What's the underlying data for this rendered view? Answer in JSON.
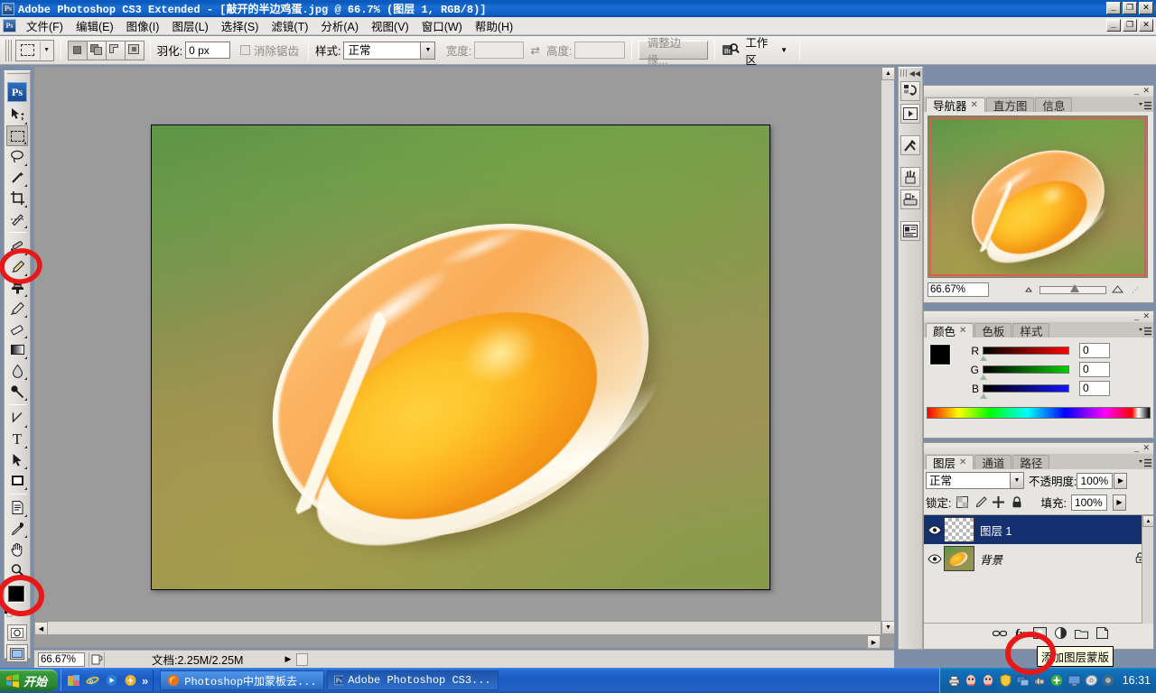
{
  "window": {
    "app_title": "Adobe Photoshop CS3 Extended - [敲开的半边鸡蛋.jpg @ 66.7% (图层 1, RGB/8)]",
    "minimize": "_",
    "maximize": "❐",
    "close": "✕"
  },
  "menubar": {
    "items": [
      {
        "label": "文件(F)"
      },
      {
        "label": "编辑(E)"
      },
      {
        "label": "图像(I)"
      },
      {
        "label": "图层(L)"
      },
      {
        "label": "选择(S)"
      },
      {
        "label": "滤镜(T)"
      },
      {
        "label": "分析(A)"
      },
      {
        "label": "视图(V)"
      },
      {
        "label": "窗口(W)"
      },
      {
        "label": "帮助(H)"
      }
    ]
  },
  "options_bar": {
    "tool": "rectangular-marquee",
    "feather_label": "羽化:",
    "feather_value": "0 px",
    "antialias_label": "消除锯齿",
    "antialias_checked": false,
    "style_label": "样式:",
    "style_value": "正常",
    "width_label": "宽度:",
    "width_value": "",
    "height_label": "高度:",
    "height_value": "",
    "swap_icon": "⇄",
    "refine_edge": "调整边缘...",
    "bridge_icon": "Br",
    "workspace_label": "工作区",
    "workspace_arrow": "▼"
  },
  "toolbox": {
    "logo": "Ps",
    "tools": [
      {
        "name": "move-tool",
        "glyph": "move"
      },
      {
        "name": "rectangular-marquee-tool",
        "glyph": "marquee",
        "selected": true
      },
      {
        "name": "lasso-tool",
        "glyph": "lasso"
      },
      {
        "name": "magic-wand-tool",
        "glyph": "wand"
      },
      {
        "name": "crop-tool",
        "glyph": "crop"
      },
      {
        "name": "slice-tool",
        "glyph": "slice"
      },
      {
        "name": "healing-brush-tool",
        "glyph": "heal"
      },
      {
        "name": "brush-tool",
        "glyph": "brush",
        "annotated": true
      },
      {
        "name": "clone-stamp-tool",
        "glyph": "stamp"
      },
      {
        "name": "history-brush-tool",
        "glyph": "historybrush"
      },
      {
        "name": "eraser-tool",
        "glyph": "eraser"
      },
      {
        "name": "gradient-tool",
        "glyph": "gradient"
      },
      {
        "name": "blur-tool",
        "glyph": "blur"
      },
      {
        "name": "dodge-tool",
        "glyph": "dodge"
      },
      {
        "name": "pen-tool",
        "glyph": "pen"
      },
      {
        "name": "type-tool",
        "glyph": "T"
      },
      {
        "name": "path-selection-tool",
        "glyph": "pathsel"
      },
      {
        "name": "rectangle-tool",
        "glyph": "rect"
      },
      {
        "name": "notes-tool",
        "glyph": "notes"
      },
      {
        "name": "eyedropper-tool",
        "glyph": "eyedropper"
      },
      {
        "name": "hand-tool",
        "glyph": "hand"
      },
      {
        "name": "zoom-tool",
        "glyph": "zoom"
      }
    ],
    "foreground_color": "#000000",
    "background_color": "#ffffff"
  },
  "document": {
    "zoom": "66.67%",
    "doc_size_label": "文档:2.25M/2.25M",
    "canvas_alt": "敲开的半边鸡蛋 — cracked egg on green-olive gradient"
  },
  "dock_strip": {
    "collapse_arrow": "◀◀",
    "buttons": [
      {
        "name": "history-panel-icon"
      },
      {
        "name": "actions-panel-icon"
      },
      {
        "name": "tool-presets-panel-icon"
      },
      {
        "name": "brushes-panel-icon"
      },
      {
        "name": "clone-source-panel-icon"
      },
      {
        "name": "character-panel-icon"
      }
    ]
  },
  "navigator_panel": {
    "tabs": [
      {
        "label": "导航器",
        "active": true,
        "closable": true
      },
      {
        "label": "直方图",
        "active": false,
        "closable": false
      },
      {
        "label": "信息",
        "active": false,
        "closable": false
      }
    ],
    "zoom_value": "66.67%",
    "view_box_color": "#e05a5a"
  },
  "color_panel": {
    "tabs": [
      {
        "label": "颜色",
        "active": true,
        "closable": true
      },
      {
        "label": "色板",
        "active": false,
        "closable": false
      },
      {
        "label": "样式",
        "active": false,
        "closable": false
      }
    ],
    "channels": [
      {
        "label": "R",
        "value": "0"
      },
      {
        "label": "G",
        "value": "0"
      },
      {
        "label": "B",
        "value": "0"
      }
    ],
    "foreground": "#000000",
    "background": "#ffffff"
  },
  "layers_panel": {
    "tabs": [
      {
        "label": "图层",
        "active": true,
        "closable": true
      },
      {
        "label": "通道",
        "active": false,
        "closable": false
      },
      {
        "label": "路径",
        "active": false,
        "closable": false
      }
    ],
    "blend_mode": "正常",
    "opacity_label": "不透明度:",
    "opacity_value": "100%",
    "lock_label": "锁定:",
    "fill_label": "填充:",
    "fill_value": "100%",
    "layers": [
      {
        "name": "图层 1",
        "selected": true,
        "visible": true,
        "locked": false,
        "thumb": "transparent"
      },
      {
        "name": "背景",
        "selected": false,
        "visible": true,
        "locked": true,
        "thumb": "egg"
      }
    ],
    "footer_buttons": [
      {
        "name": "link-layers-icon",
        "glyph": "🔗"
      },
      {
        "name": "layer-style-icon",
        "glyph": "fx"
      },
      {
        "name": "add-layer-mask-icon",
        "glyph": "mask",
        "annotated": true
      },
      {
        "name": "new-fill-adjustment-icon",
        "glyph": "halfcircle"
      },
      {
        "name": "new-group-icon",
        "glyph": "folder"
      },
      {
        "name": "new-layer-icon",
        "glyph": "page"
      },
      {
        "name": "delete-layer-icon",
        "glyph": "trash"
      }
    ]
  },
  "tooltip": {
    "text": "添加图层蒙版"
  },
  "taskbar": {
    "start_label": "开始",
    "quick_launch": [
      {
        "name": "show-desktop-icon"
      },
      {
        "name": "internet-explorer-icon"
      },
      {
        "name": "media-player-icon"
      },
      {
        "name": "thunder-download-icon"
      }
    ],
    "overflow": "»",
    "tasks": [
      {
        "label": "Photoshop中加蒙板去...",
        "active": false,
        "icon": "firefox-icon"
      },
      {
        "label": "Adobe Photoshop CS3...",
        "active": true,
        "icon": "photoshop-icon"
      }
    ],
    "tray_icons": [
      {
        "name": "tray-printer-icon"
      },
      {
        "name": "tray-qq-icon-1"
      },
      {
        "name": "tray-qq-icon-2"
      },
      {
        "name": "tray-shield-icon"
      },
      {
        "name": "tray-network-icon"
      },
      {
        "name": "tray-sound-icon"
      },
      {
        "name": "tray-update-icon"
      },
      {
        "name": "tray-monitor-icon"
      },
      {
        "name": "tray-disc-icon"
      },
      {
        "name": "tray-antivirus-icon"
      }
    ],
    "clock": "16:31"
  }
}
